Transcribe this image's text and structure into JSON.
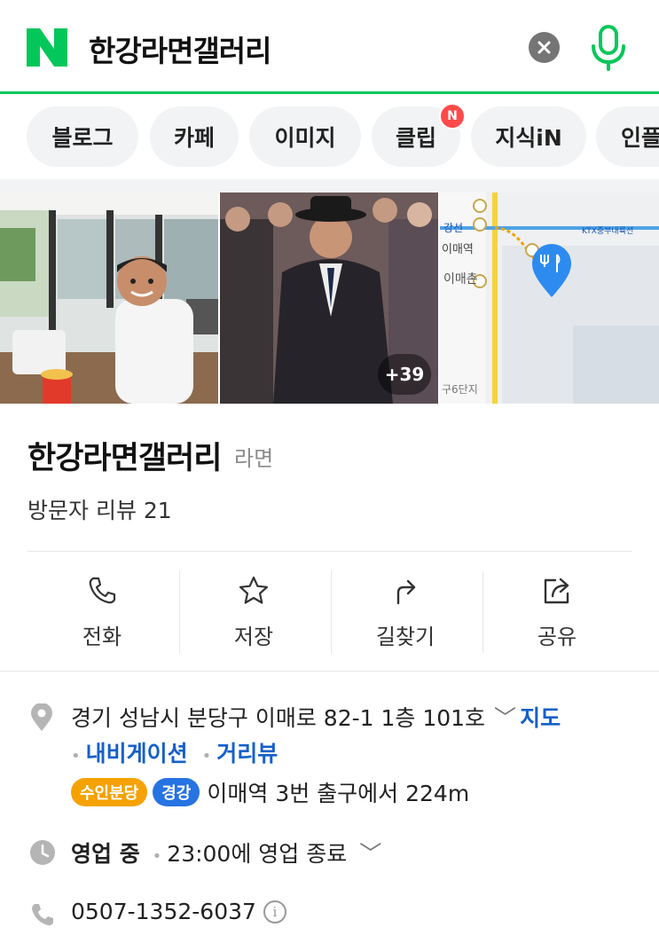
{
  "search": {
    "query": "한강라면갤러리"
  },
  "tabs": [
    {
      "label": "블로그"
    },
    {
      "label": "카페"
    },
    {
      "label": "이미지"
    },
    {
      "label": "클립",
      "badge": "N"
    },
    {
      "label": "지식iN"
    },
    {
      "label": "인플"
    }
  ],
  "photos": {
    "more_count": "+39"
  },
  "map": {
    "labels": [
      "이매역",
      "이매촌",
      "KTX중부내륙선",
      "구6단지"
    ],
    "line_label": "강선"
  },
  "place": {
    "name": "한강라면갤러리",
    "category": "라면",
    "review": "방문자 리뷰 21"
  },
  "actions": [
    {
      "label": "전화",
      "icon": "phone-icon"
    },
    {
      "label": "저장",
      "icon": "star-icon"
    },
    {
      "label": "길찾기",
      "icon": "directions-icon"
    },
    {
      "label": "공유",
      "icon": "share-icon"
    }
  ],
  "details": {
    "address": "경기 성남시 분당구 이매로 82-1 1층 101호",
    "map_link": "지도",
    "navigation_link": "내비게이션",
    "streetview_link": "거리뷰",
    "subway_lines": [
      {
        "label": "수인분당",
        "color": "#f5a200"
      },
      {
        "label": "경강",
        "color": "#2673e3"
      }
    ],
    "station_info": "이매역 3번 출구에서 224m",
    "hours_status": "영업 중",
    "hours_detail": "23:00에 영업 종료",
    "phone": "0507-1352-6037"
  },
  "colors": {
    "brand": "#03c75a",
    "link": "#1560c9",
    "badge": "#ff4a4a"
  }
}
